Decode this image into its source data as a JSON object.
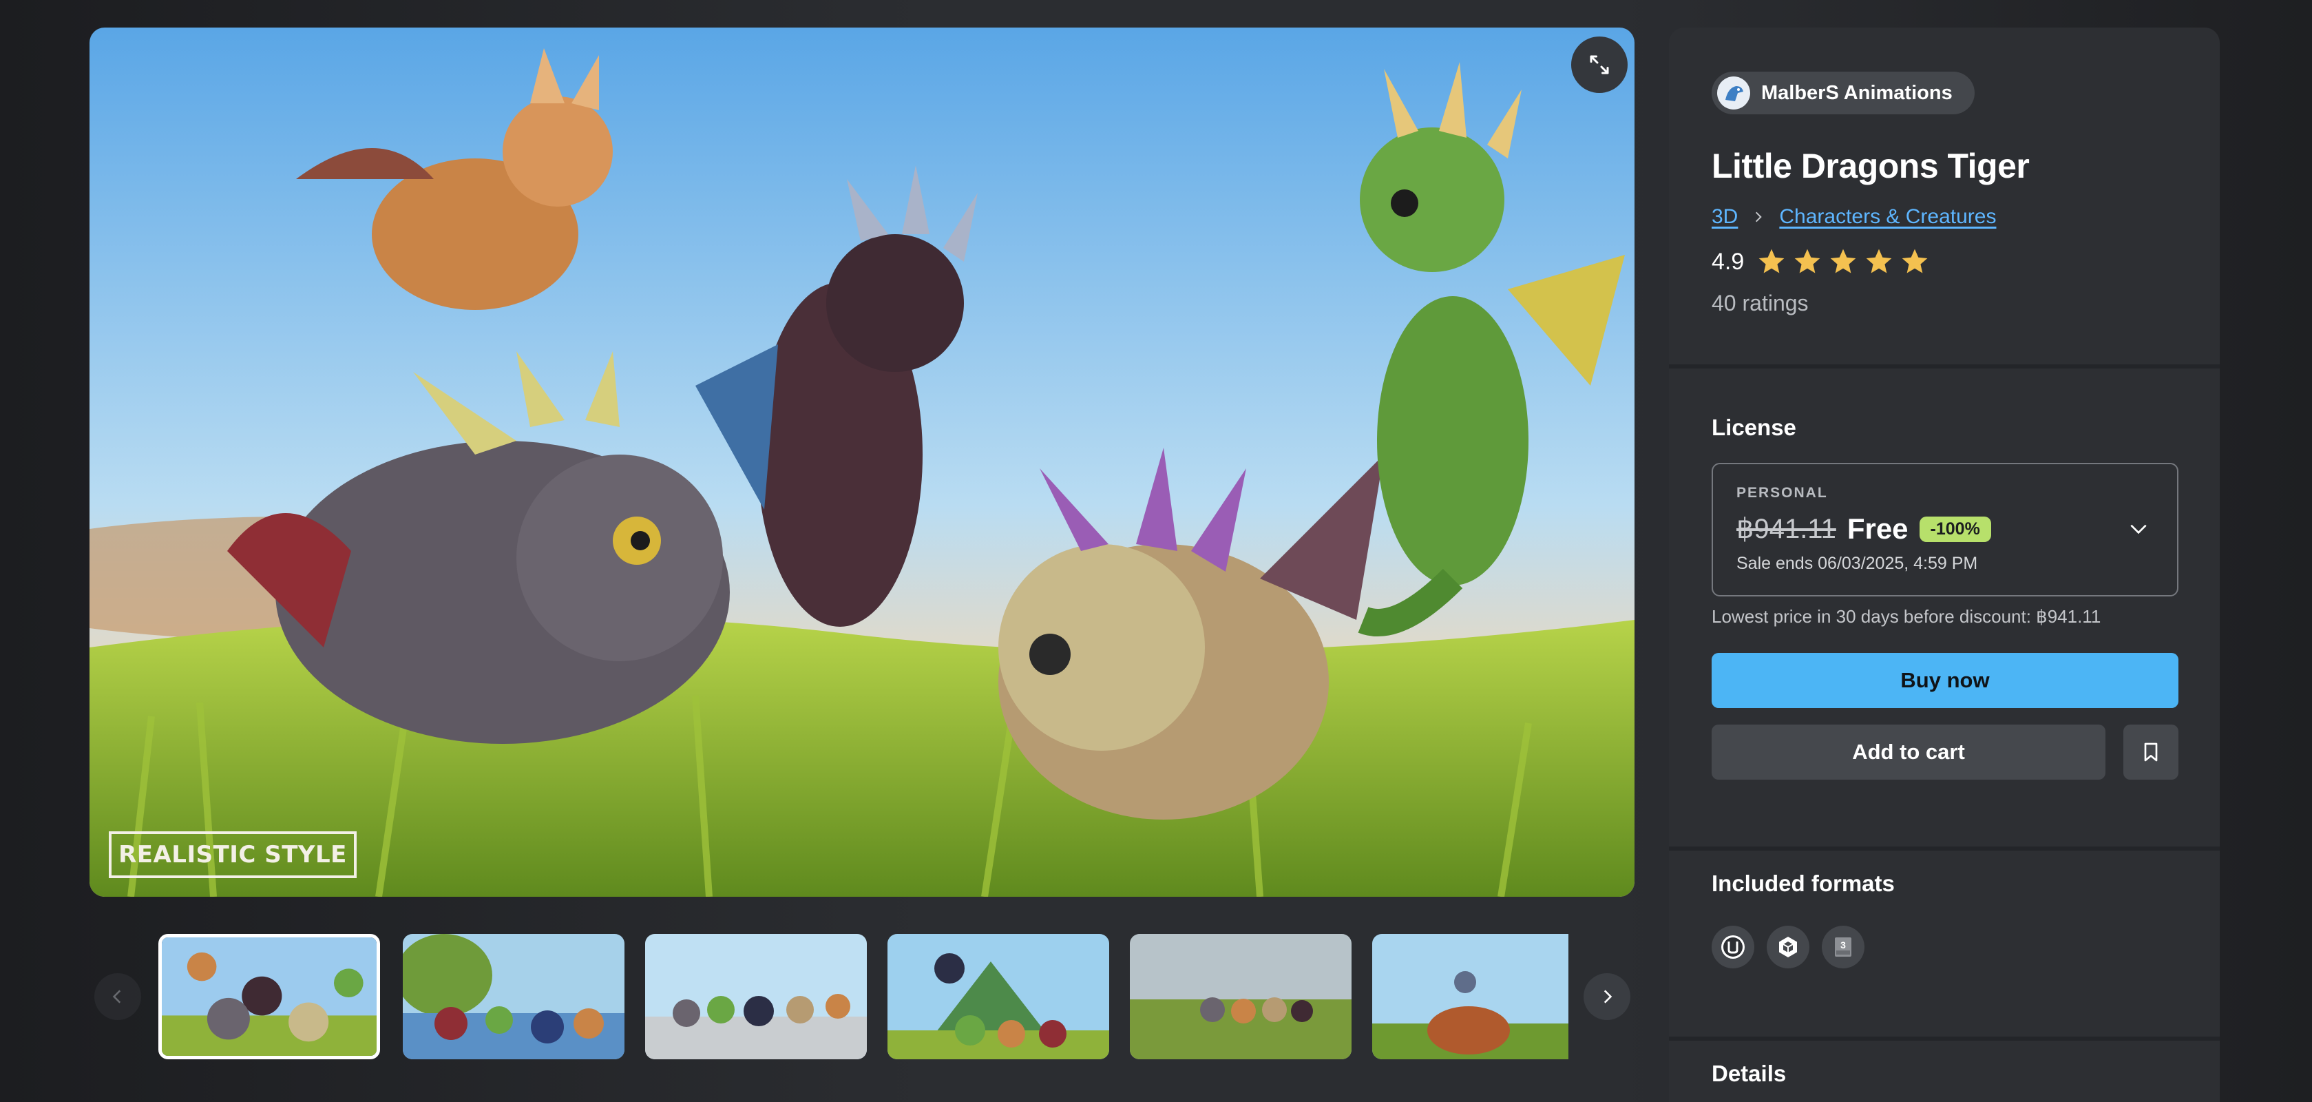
{
  "gallery": {
    "hero_caption": "REALISTIC STYLE",
    "thumbnails": [
      {
        "name": "thumb-1",
        "active": true
      },
      {
        "name": "thumb-2",
        "active": false
      },
      {
        "name": "thumb-3",
        "active": false
      },
      {
        "name": "thumb-4",
        "active": false
      },
      {
        "name": "thumb-5",
        "active": false
      },
      {
        "name": "thumb-6",
        "active": false
      }
    ],
    "icons": {
      "expand": "expand-icon",
      "prev": "chevron-left-icon",
      "next": "chevron-right-icon"
    }
  },
  "product": {
    "seller": "MalberS Animations",
    "title": "Little Dragons Tiger",
    "breadcrumb": [
      "3D",
      "Characters & Creatures"
    ],
    "rating": "4.9",
    "stars": 5,
    "rating_count": "40 ratings"
  },
  "license": {
    "heading": "License",
    "tier": "PERSONAL",
    "old_price": "฿941.11",
    "price": "Free",
    "discount": "-100%",
    "sale_ends": "Sale ends 06/03/2025, 4:59 PM",
    "lowest_price": "Lowest price in 30 days before discount: ฿941.11",
    "buy_label": "Buy now",
    "cart_label": "Add to cart"
  },
  "formats": {
    "heading": "Included formats",
    "items": [
      "unreal-engine-icon",
      "unity-icon",
      "3ds-max-icon"
    ]
  },
  "details": {
    "heading": "Details"
  },
  "colors": {
    "accent_blue": "#4cb5f5",
    "link_blue": "#5eb6ff",
    "badge_green": "#b7e06b",
    "star_gold": "#f4c150",
    "panel_bg": "#2d2f33"
  }
}
